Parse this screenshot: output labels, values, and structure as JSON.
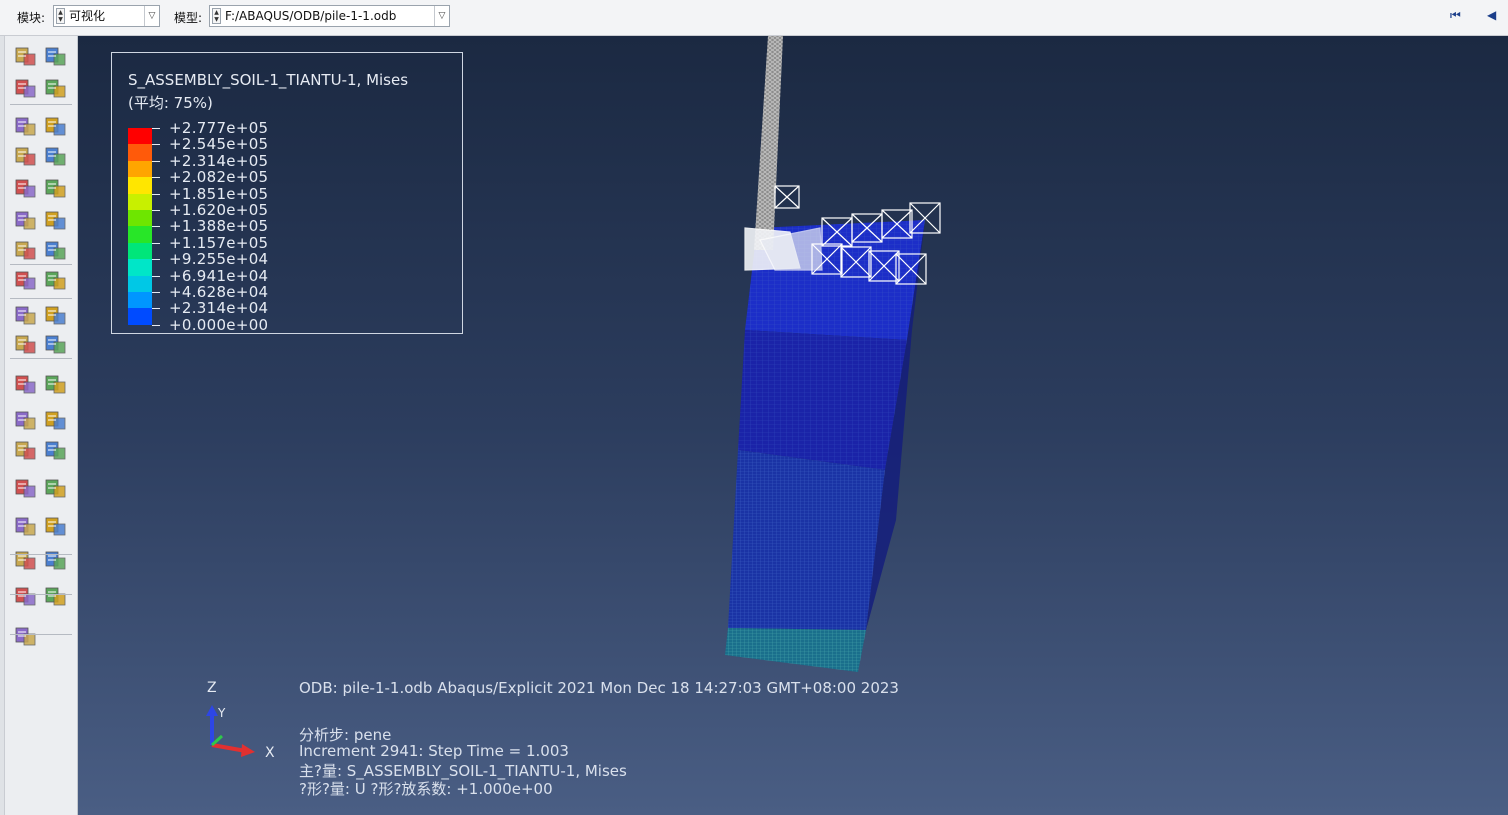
{
  "context_bar": {
    "module_label": "模块:",
    "module_value": "可视化",
    "model_label": "模型:",
    "model_value": "F:/ABAQUS/ODB/pile-1-1.odb",
    "nav_first": "⏮",
    "nav_prev": "◀"
  },
  "legend": {
    "title": "S_ASSEMBLY_SOIL-1_TIANTU-1, Mises",
    "subtitle": "(平均: 75%)",
    "values": [
      "+2.777e+05",
      "+2.545e+05",
      "+2.314e+05",
      "+2.082e+05",
      "+1.851e+05",
      "+1.620e+05",
      "+1.388e+05",
      "+1.157e+05",
      "+9.255e+04",
      "+6.941e+04",
      "+4.628e+04",
      "+2.314e+04",
      "+0.000e+00"
    ],
    "colors": [
      "#ff0000",
      "#ff5a0a",
      "#ffa500",
      "#ffe600",
      "#c8f000",
      "#6ee600",
      "#28e628",
      "#00e67a",
      "#00e6c8",
      "#00c8e6",
      "#0096ff",
      "#004bff",
      "#0000ff"
    ]
  },
  "info": {
    "odb_line": "ODB: pile-1-1.odb    Abaqus/Explicit 2021    Mon Dec 18 14:27:03 GMT+08:00 2023",
    "step_line": "分析步: pene",
    "increment_line": "Increment      2941: Step Time =    1.003",
    "primary_line": "主?量: S_ASSEMBLY_SOIL-1_TIANTU-1, Mises",
    "deformed_line": "?形?量: U   ?形?放系数: +1.000e+00"
  },
  "triad": {
    "z": "Z",
    "y": "Y",
    "x": "X"
  },
  "tools": [
    "results-step-icon",
    "results-frame-icon",
    "field-output-icon",
    "result-options-icon",
    "plot-undeformed-icon",
    "plot-deformed-icon",
    "plot-contours-icon",
    "contour-options-icon",
    "plot-symbols-icon",
    "symbol-options-icon",
    "plot-material-icon",
    "material-options-icon",
    "animate-scale-icon",
    "animate-time-icon",
    "animate-harmonic-icon",
    "animation-options-icon",
    "view-cut-icon",
    "view-cut-manager-icon",
    "xy-data-icon",
    "xy-data-manager-icon",
    "path-icon",
    "xy-plot-icon",
    "stream-icon",
    "stream-manager-icon",
    "display-group-icon",
    "display-group-manager-icon",
    "free-body-icon",
    "free-body-manager-icon",
    "view-cut-plane-icon",
    "view-cut-options-icon",
    "query-icon",
    "query-manager-icon",
    "probe-icon"
  ]
}
